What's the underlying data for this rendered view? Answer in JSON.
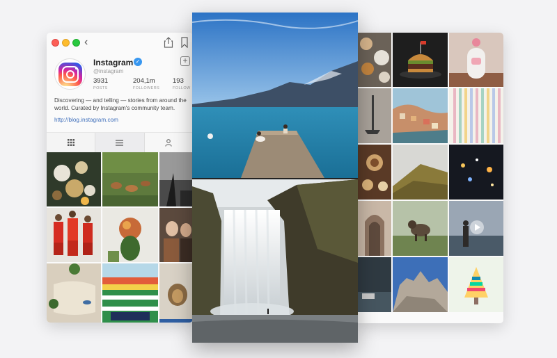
{
  "profile": {
    "username": "Instagram",
    "handle": "@instagram",
    "verified": true,
    "stats": [
      {
        "value": "3931",
        "label": "POSTS"
      },
      {
        "value": "204,1m",
        "label": "FOLLOWERS"
      },
      {
        "value": "193",
        "label": "FOLLOW"
      }
    ],
    "bio": "Discovering — and telling — stories from around the world. Curated by Instagram's community team.",
    "link": "http://blog.instagram.com"
  },
  "tabs": [
    {
      "icon": "grid-icon"
    },
    {
      "icon": "list-icon"
    },
    {
      "icon": "person-tag-icon"
    }
  ],
  "window_controls": [
    "close",
    "minimize",
    "zoom"
  ],
  "toolbar_icons": [
    "chevron-left-icon",
    "share-icon",
    "bookmark-icon",
    "add-icon"
  ],
  "colors": {
    "link": "#3f6fbb",
    "verified": "#3897f0",
    "background": "#f3f3f5"
  }
}
